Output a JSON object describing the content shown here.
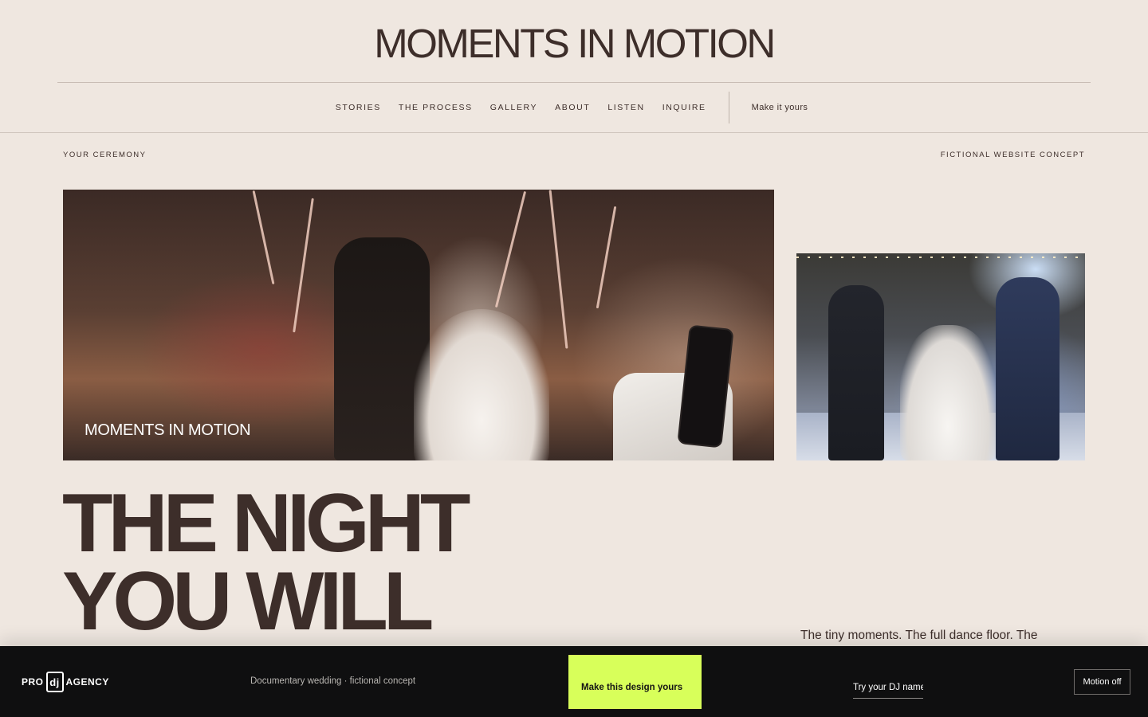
{
  "header": {
    "site_title": "MOMENTS IN MOTION",
    "nav": [
      {
        "label": "STORIES"
      },
      {
        "label": "THE PROCESS"
      },
      {
        "label": "GALLERY"
      },
      {
        "label": "ABOUT"
      },
      {
        "label": "LISTEN"
      },
      {
        "label": "INQUIRE"
      }
    ],
    "cta_label": "Make it yours"
  },
  "eyebrow": {
    "left": "YOUR CEREMONY",
    "right": "FICTIONAL WEBSITE CONCEPT"
  },
  "hero": {
    "photo_caption": "MOMENTS IN MOTION",
    "headline_line1": "THE NIGHT",
    "headline_line2": "YOU WILL",
    "lede": "The tiny moments. The full dance floor. The"
  },
  "footer": {
    "brand_prefix": "PRO",
    "brand_mark": "dj",
    "brand_suffix": "AGENCY",
    "note": "Documentary wedding · fictional concept",
    "cta_label": "Make this design yours",
    "dj_name_placeholder": "Try your DJ name",
    "motion_toggle_label": "Motion off"
  },
  "colors": {
    "background": "#efe7e0",
    "text": "#3d2e2a",
    "footer_bg": "#0f0f10",
    "cta_accent": "#d8ff5a"
  }
}
